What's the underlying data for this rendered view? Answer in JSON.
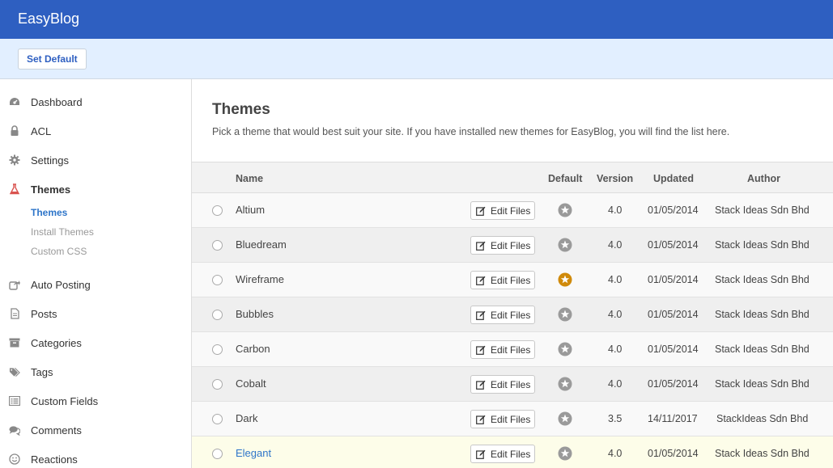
{
  "app": {
    "title": "EasyBlog"
  },
  "toolbar": {
    "set_default_label": "Set Default"
  },
  "sidebar": {
    "items": [
      {
        "label": "Dashboard",
        "icon": "dashboard-icon"
      },
      {
        "label": "ACL",
        "icon": "lock-icon"
      },
      {
        "label": "Settings",
        "icon": "gear-icon"
      },
      {
        "label": "Themes",
        "icon": "flask-icon"
      },
      {
        "label": "Auto Posting",
        "icon": "share-icon"
      },
      {
        "label": "Posts",
        "icon": "document-icon"
      },
      {
        "label": "Categories",
        "icon": "archive-icon"
      },
      {
        "label": "Tags",
        "icon": "tags-icon"
      },
      {
        "label": "Custom Fields",
        "icon": "list-icon"
      },
      {
        "label": "Comments",
        "icon": "comments-icon"
      },
      {
        "label": "Reactions",
        "icon": "smile-icon"
      }
    ],
    "theme_subitems": [
      {
        "label": "Themes"
      },
      {
        "label": "Install Themes"
      },
      {
        "label": "Custom CSS"
      }
    ]
  },
  "main": {
    "title": "Themes",
    "description": "Pick a theme that would best suit your site. If you have installed new themes for EasyBlog, you will find the list here."
  },
  "table": {
    "headers": {
      "name": "Name",
      "default": "Default",
      "version": "Version",
      "updated": "Updated",
      "author": "Author"
    },
    "edit_label": "Edit Files",
    "rows": [
      {
        "name": "Altium",
        "default": false,
        "version": "4.0",
        "updated": "01/05/2014",
        "author": "Stack Ideas Sdn Bhd"
      },
      {
        "name": "Bluedream",
        "default": false,
        "version": "4.0",
        "updated": "01/05/2014",
        "author": "Stack Ideas Sdn Bhd"
      },
      {
        "name": "Wireframe",
        "default": true,
        "version": "4.0",
        "updated": "01/05/2014",
        "author": "Stack Ideas Sdn Bhd"
      },
      {
        "name": "Bubbles",
        "default": false,
        "version": "4.0",
        "updated": "01/05/2014",
        "author": "Stack Ideas Sdn Bhd"
      },
      {
        "name": "Carbon",
        "default": false,
        "version": "4.0",
        "updated": "01/05/2014",
        "author": "Stack Ideas Sdn Bhd"
      },
      {
        "name": "Cobalt",
        "default": false,
        "version": "4.0",
        "updated": "01/05/2014",
        "author": "Stack Ideas Sdn Bhd"
      },
      {
        "name": "Dark",
        "default": false,
        "version": "3.5",
        "updated": "14/11/2017",
        "author": "StackIdeas Sdn Bhd"
      },
      {
        "name": "Elegant",
        "default": false,
        "version": "4.0",
        "updated": "01/05/2014",
        "author": "Stack Ideas Sdn Bhd"
      }
    ]
  },
  "colors": {
    "topbar": "#2e5fc1",
    "toolbar": "#e2efff",
    "link": "#2e75c9",
    "default_star": "#d08a0b",
    "inactive_star": "#9a9a9a",
    "themes_icon": "#d9534f"
  }
}
